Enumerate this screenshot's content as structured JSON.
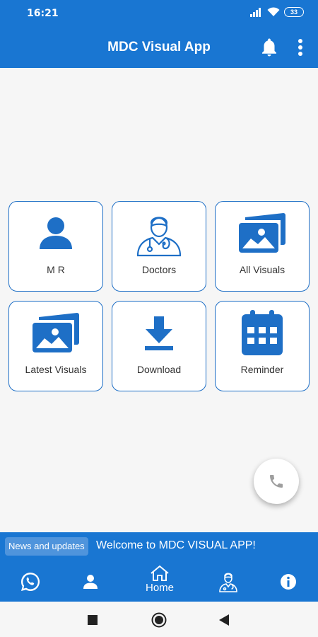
{
  "status_bar": {
    "time": "16:21",
    "battery": "33"
  },
  "app_bar": {
    "title": "MDC Visual App"
  },
  "tiles": [
    {
      "label": "M R"
    },
    {
      "label": "Doctors"
    },
    {
      "label": "All Visuals"
    },
    {
      "label": "Latest Visuals"
    },
    {
      "label": "Download"
    },
    {
      "label": "Reminder"
    }
  ],
  "news": {
    "chip": "News and updates",
    "message": "Welcome to MDC VISUAL APP!"
  },
  "bottom_nav": {
    "home_label": "Home"
  },
  "colors": {
    "primary": "#1976d2",
    "accent": "#1e6fc6",
    "background": "#f6f6f6"
  }
}
